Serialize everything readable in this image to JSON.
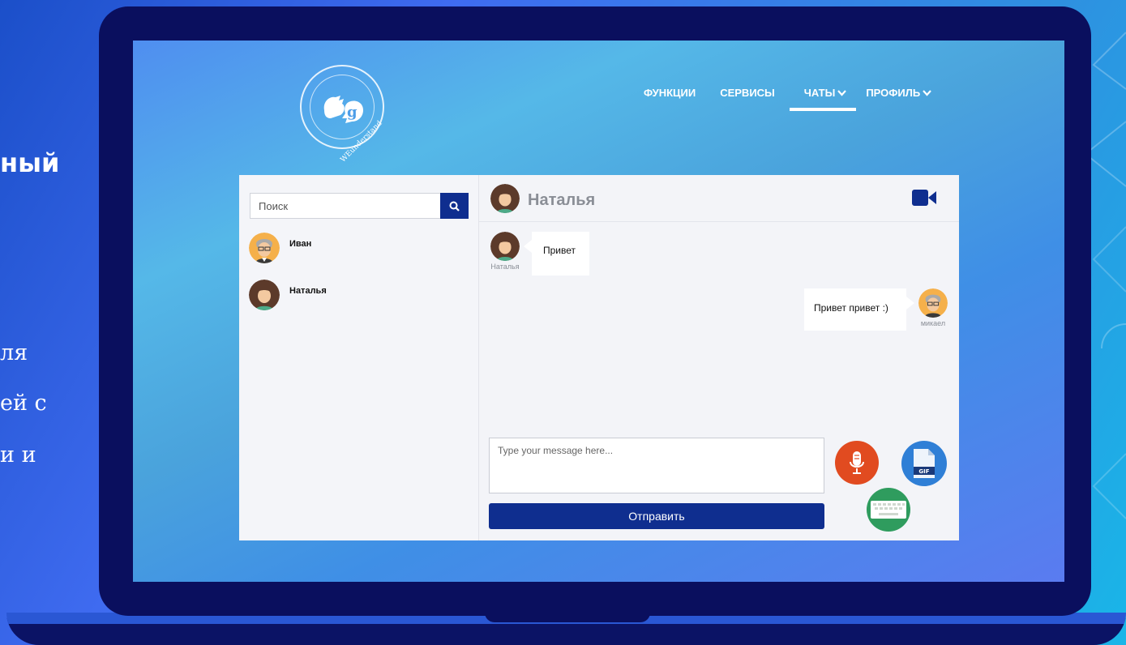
{
  "slide": {
    "title_fragment": "ный",
    "text_lines": [
      "ля",
      "ей с",
      "и и"
    ]
  },
  "site": {
    "logo_text": "WEunderstand",
    "nav": [
      {
        "label": "ФУНКЦИИ"
      },
      {
        "label": "СЕРВИСЫ"
      },
      {
        "label": "ЧАТЫ",
        "has_dropdown": true,
        "active": true
      },
      {
        "label": "ПРОФИЛЬ",
        "has_dropdown": true
      }
    ]
  },
  "chat": {
    "search_placeholder": "Поиск",
    "contacts": [
      {
        "name": "Иван",
        "avatar": "male-avatar"
      },
      {
        "name": "Наталья",
        "avatar": "female-avatar"
      }
    ],
    "header": {
      "name": "Наталья"
    },
    "messages": [
      {
        "direction": "in",
        "author": "Наталья",
        "text": "Привет"
      },
      {
        "direction": "out",
        "author": "микаел",
        "text": "Привет привет :)"
      }
    ],
    "compose_placeholder": "Type your message here...",
    "send_label": "Отправить",
    "gif_label": "GIF"
  },
  "colors": {
    "brand_dark": "#0f2e8f",
    "mic": "#e14b20",
    "gif": "#2f7fd6",
    "keyboard": "#2f9c5e"
  }
}
